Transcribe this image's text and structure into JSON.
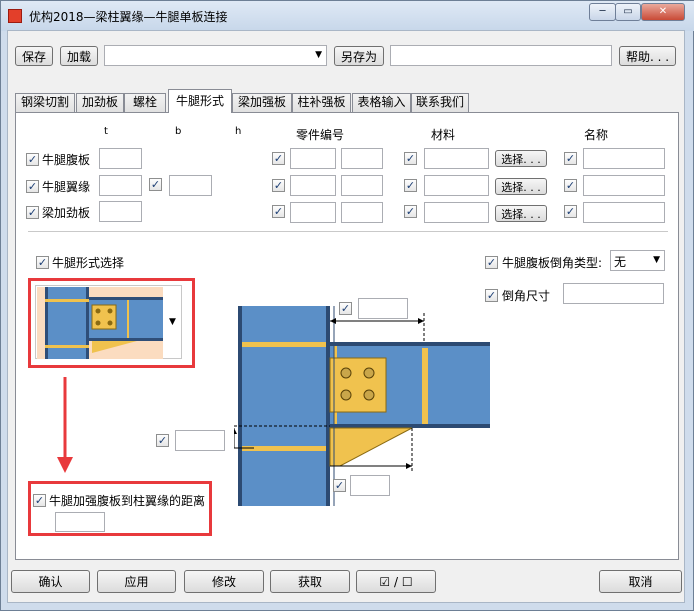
{
  "window": {
    "title": "优构2018—梁柱翼缘—牛腿单板连接",
    "controls": {
      "minimize": "─",
      "maximize": "▭",
      "close": "✕"
    }
  },
  "toolbar": {
    "save_label": "保存",
    "load_label": "加载",
    "config_select_value": "",
    "save_as_label": "另存为",
    "save_as_value": "",
    "help_label": "帮助. . ."
  },
  "tabs": [
    {
      "label": "钢梁切割"
    },
    {
      "label": "加劲板"
    },
    {
      "label": "螺栓"
    },
    {
      "label": "牛腿形式"
    },
    {
      "label": "梁加强板"
    },
    {
      "label": "柱补强板"
    },
    {
      "label": "表格输入"
    },
    {
      "label": "联系我们"
    }
  ],
  "table": {
    "col_t": "t",
    "col_b": "b",
    "col_h": "h",
    "col_part_no": "零件编号",
    "col_material": "材料",
    "col_name": "名称",
    "select_label": "选择. . .",
    "rows": [
      {
        "label": "牛腿腹板"
      },
      {
        "label": "牛腿翼缘"
      },
      {
        "label": "梁加劲板"
      }
    ]
  },
  "form": {
    "bracket_type_label": "牛腿形式选择",
    "chamfer_type_label": "牛腿腹板倒角类型:",
    "chamfer_type_value": "无",
    "chamfer_size_label": "倒角尺寸",
    "distance_label": "牛腿加强腹板到柱翼缘的距离"
  },
  "footer": {
    "ok_label": "确认",
    "apply_label": "应用",
    "modify_label": "修改",
    "get_label": "获取",
    "toggle_label": "☑ / ☐",
    "cancel_label": "取消"
  },
  "colors": {
    "steel_blue": "#5b8fc7",
    "plate_yellow": "#f0c24e",
    "highlight_red": "#e8393c"
  }
}
